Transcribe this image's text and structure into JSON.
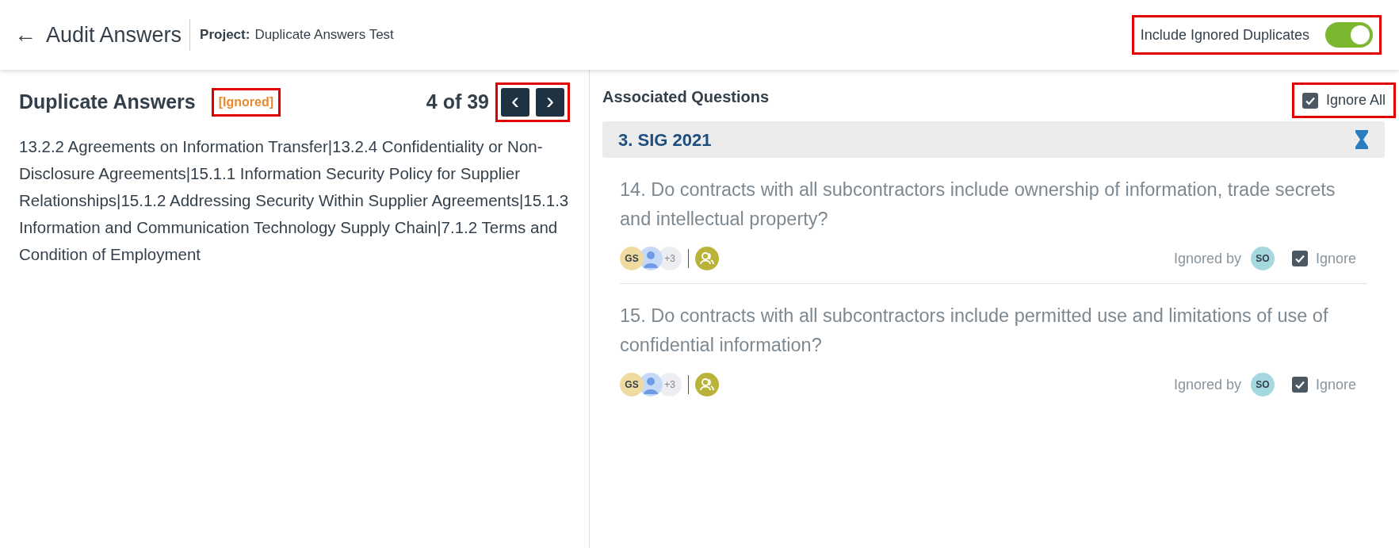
{
  "header": {
    "back_label": "←",
    "title": "Audit Answers",
    "project_label": "Project:",
    "project_name": "Duplicate Answers Test",
    "toggle": {
      "label": "Include Ignored Duplicates",
      "on": true,
      "highlighted": true
    }
  },
  "left": {
    "title": "Duplicate Answers",
    "status_tag": {
      "text": "[Ignored]",
      "highlighted": true
    },
    "counter": "4 of 39",
    "nav": {
      "prev": "‹",
      "next": "›",
      "highlighted": true
    },
    "answer": "13.2.2 Agreements on Information Transfer|13.2.4 Confidentiality or Non-Disclosure Agreements|15.1.1 Information Security Policy for Supplier Relationships|15.1.2 Addressing Security Within Supplier Agreements|15.1.3 Information and Communication Technology Supply Chain|7.1.2 Terms and Condition of Employment"
  },
  "right": {
    "title": "Associated Questions",
    "ignore_all": {
      "label": "Ignore All",
      "checked": true,
      "highlighted": true
    },
    "group": {
      "title": "3. SIG 2021",
      "questions": [
        {
          "text": "14. Do contracts with all subcontractors include ownership of information, trade secrets and intellectual property?",
          "assignee_initials": "GS",
          "extra_count": "+3",
          "ignored_by_label": "Ignored by",
          "ignored_by_initials": "SO",
          "ignore_label": "Ignore",
          "ignored": true
        },
        {
          "text": "15. Do contracts with all subcontractors include permitted use and limitations of use of confidential information?",
          "assignee_initials": "GS",
          "extra_count": "+3",
          "ignored_by_label": "Ignored by",
          "ignored_by_initials": "SO",
          "ignore_label": "Ignore",
          "ignored": true
        }
      ]
    }
  }
}
